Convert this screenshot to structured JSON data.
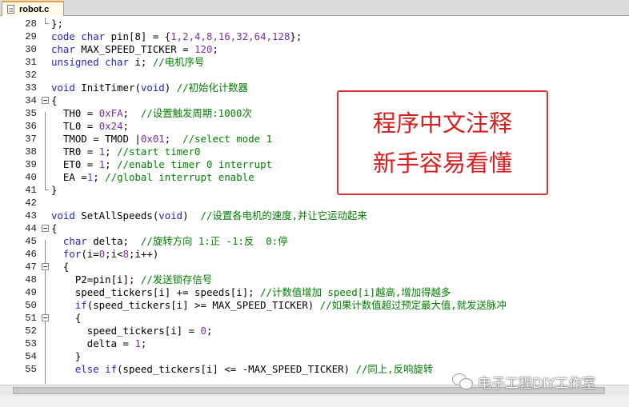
{
  "tab": {
    "filename": "robot.c"
  },
  "annotation": {
    "line1": "程序中文注释",
    "line2": "新手容易看懂"
  },
  "watermark": {
    "text": "电子工程DIY工作室"
  },
  "lines": [
    {
      "n": "28",
      "segs": [
        [
          "tx",
          "};"
        ]
      ]
    },
    {
      "n": "29",
      "segs": [
        [
          "kw",
          "code char"
        ],
        [
          "tx",
          " pin[8] = {"
        ],
        [
          "num",
          "1,2,4,8,16,32,64,128"
        ],
        [
          "tx",
          "};"
        ]
      ]
    },
    {
      "n": "30",
      "segs": [
        [
          "kw",
          "char"
        ],
        [
          "tx",
          " MAX_SPEED_TICKER = "
        ],
        [
          "num",
          "120"
        ],
        [
          "tx",
          ";"
        ]
      ]
    },
    {
      "n": "31",
      "segs": [
        [
          "kw",
          "unsigned char"
        ],
        [
          "tx",
          " i; "
        ],
        [
          "cm",
          "//电机序号"
        ]
      ]
    },
    {
      "n": "32",
      "segs": []
    },
    {
      "n": "33",
      "segs": [
        [
          "kw",
          "void"
        ],
        [
          "tx",
          " InitTimer("
        ],
        [
          "kw",
          "void"
        ],
        [
          "tx",
          ") "
        ],
        [
          "cm",
          "//初始化计数器"
        ]
      ]
    },
    {
      "n": "34",
      "segs": [
        [
          "tx",
          "{"
        ]
      ]
    },
    {
      "n": "35",
      "segs": [
        [
          "tx",
          "  TH0 = "
        ],
        [
          "num",
          "0xFA"
        ],
        [
          "tx",
          ";  "
        ],
        [
          "cm",
          "//设置触发周期:1000次"
        ]
      ]
    },
    {
      "n": "36",
      "segs": [
        [
          "tx",
          "  TL0 = "
        ],
        [
          "num",
          "0x24"
        ],
        [
          "tx",
          ";"
        ]
      ]
    },
    {
      "n": "37",
      "segs": [
        [
          "tx",
          "  TMOD = TMOD |"
        ],
        [
          "num",
          "0x01"
        ],
        [
          "tx",
          ";  "
        ],
        [
          "cm",
          "//select mode 1"
        ]
      ]
    },
    {
      "n": "38",
      "segs": [
        [
          "tx",
          "  TR0 = "
        ],
        [
          "num",
          "1"
        ],
        [
          "tx",
          "; "
        ],
        [
          "cm",
          "//start timer0"
        ]
      ]
    },
    {
      "n": "39",
      "segs": [
        [
          "tx",
          "  ET0 = "
        ],
        [
          "num",
          "1"
        ],
        [
          "tx",
          "; "
        ],
        [
          "cm",
          "//enable timer 0 interrupt"
        ]
      ]
    },
    {
      "n": "40",
      "segs": [
        [
          "tx",
          "  EA ="
        ],
        [
          "num",
          "1"
        ],
        [
          "tx",
          "; "
        ],
        [
          "cm",
          "//global interrupt enable"
        ]
      ]
    },
    {
      "n": "41",
      "segs": [
        [
          "tx",
          "}"
        ]
      ]
    },
    {
      "n": "42",
      "segs": []
    },
    {
      "n": "43",
      "segs": [
        [
          "kw",
          "void"
        ],
        [
          "tx",
          " SetAllSpeeds("
        ],
        [
          "kw",
          "void"
        ],
        [
          "tx",
          ")  "
        ],
        [
          "cm",
          "//设置各电机的速度,并让它运动起来"
        ]
      ]
    },
    {
      "n": "44",
      "segs": [
        [
          "tx",
          "{"
        ]
      ]
    },
    {
      "n": "45",
      "segs": [
        [
          "tx",
          "  "
        ],
        [
          "kw",
          "char"
        ],
        [
          "tx",
          " delta;  "
        ],
        [
          "cm",
          "//旋转方向 1:正 -1:反  0:停"
        ]
      ]
    },
    {
      "n": "46",
      "segs": [
        [
          "tx",
          "  "
        ],
        [
          "kw",
          "for"
        ],
        [
          "tx",
          "(i="
        ],
        [
          "num",
          "0"
        ],
        [
          "tx",
          ";i<"
        ],
        [
          "num",
          "8"
        ],
        [
          "tx",
          ";i++)"
        ]
      ]
    },
    {
      "n": "47",
      "segs": [
        [
          "tx",
          "  {"
        ]
      ]
    },
    {
      "n": "48",
      "segs": [
        [
          "tx",
          "    P2=pin[i]; "
        ],
        [
          "cm",
          "//发送锁存信号"
        ]
      ]
    },
    {
      "n": "49",
      "segs": [
        [
          "tx",
          "    speed_tickers[i] += speeds[i]; "
        ],
        [
          "cm",
          "//计数值增加 speed[i]越高,增加得越多"
        ]
      ]
    },
    {
      "n": "50",
      "segs": [
        [
          "tx",
          "    "
        ],
        [
          "kw",
          "if"
        ],
        [
          "tx",
          "(speed_tickers[i] >= MAX_SPEED_TICKER) "
        ],
        [
          "cm",
          "//如果计数值超过预定最大值,就发送脉冲"
        ]
      ]
    },
    {
      "n": "51",
      "segs": [
        [
          "tx",
          "    {"
        ]
      ]
    },
    {
      "n": "52",
      "segs": [
        [
          "tx",
          "      speed_tickers[i] = "
        ],
        [
          "num",
          "0"
        ],
        [
          "tx",
          ";"
        ]
      ]
    },
    {
      "n": "53",
      "segs": [
        [
          "tx",
          "      delta = "
        ],
        [
          "num",
          "1"
        ],
        [
          "tx",
          ";"
        ]
      ]
    },
    {
      "n": "54",
      "segs": [
        [
          "tx",
          "    }"
        ]
      ]
    },
    {
      "n": "55",
      "segs": [
        [
          "tx",
          "    "
        ],
        [
          "kw",
          "else if"
        ],
        [
          "tx",
          "(speed_tickers[i] <= -MAX_SPEED_TICKER) "
        ],
        [
          "cm",
          "//同上,反响旋转"
        ]
      ]
    }
  ]
}
